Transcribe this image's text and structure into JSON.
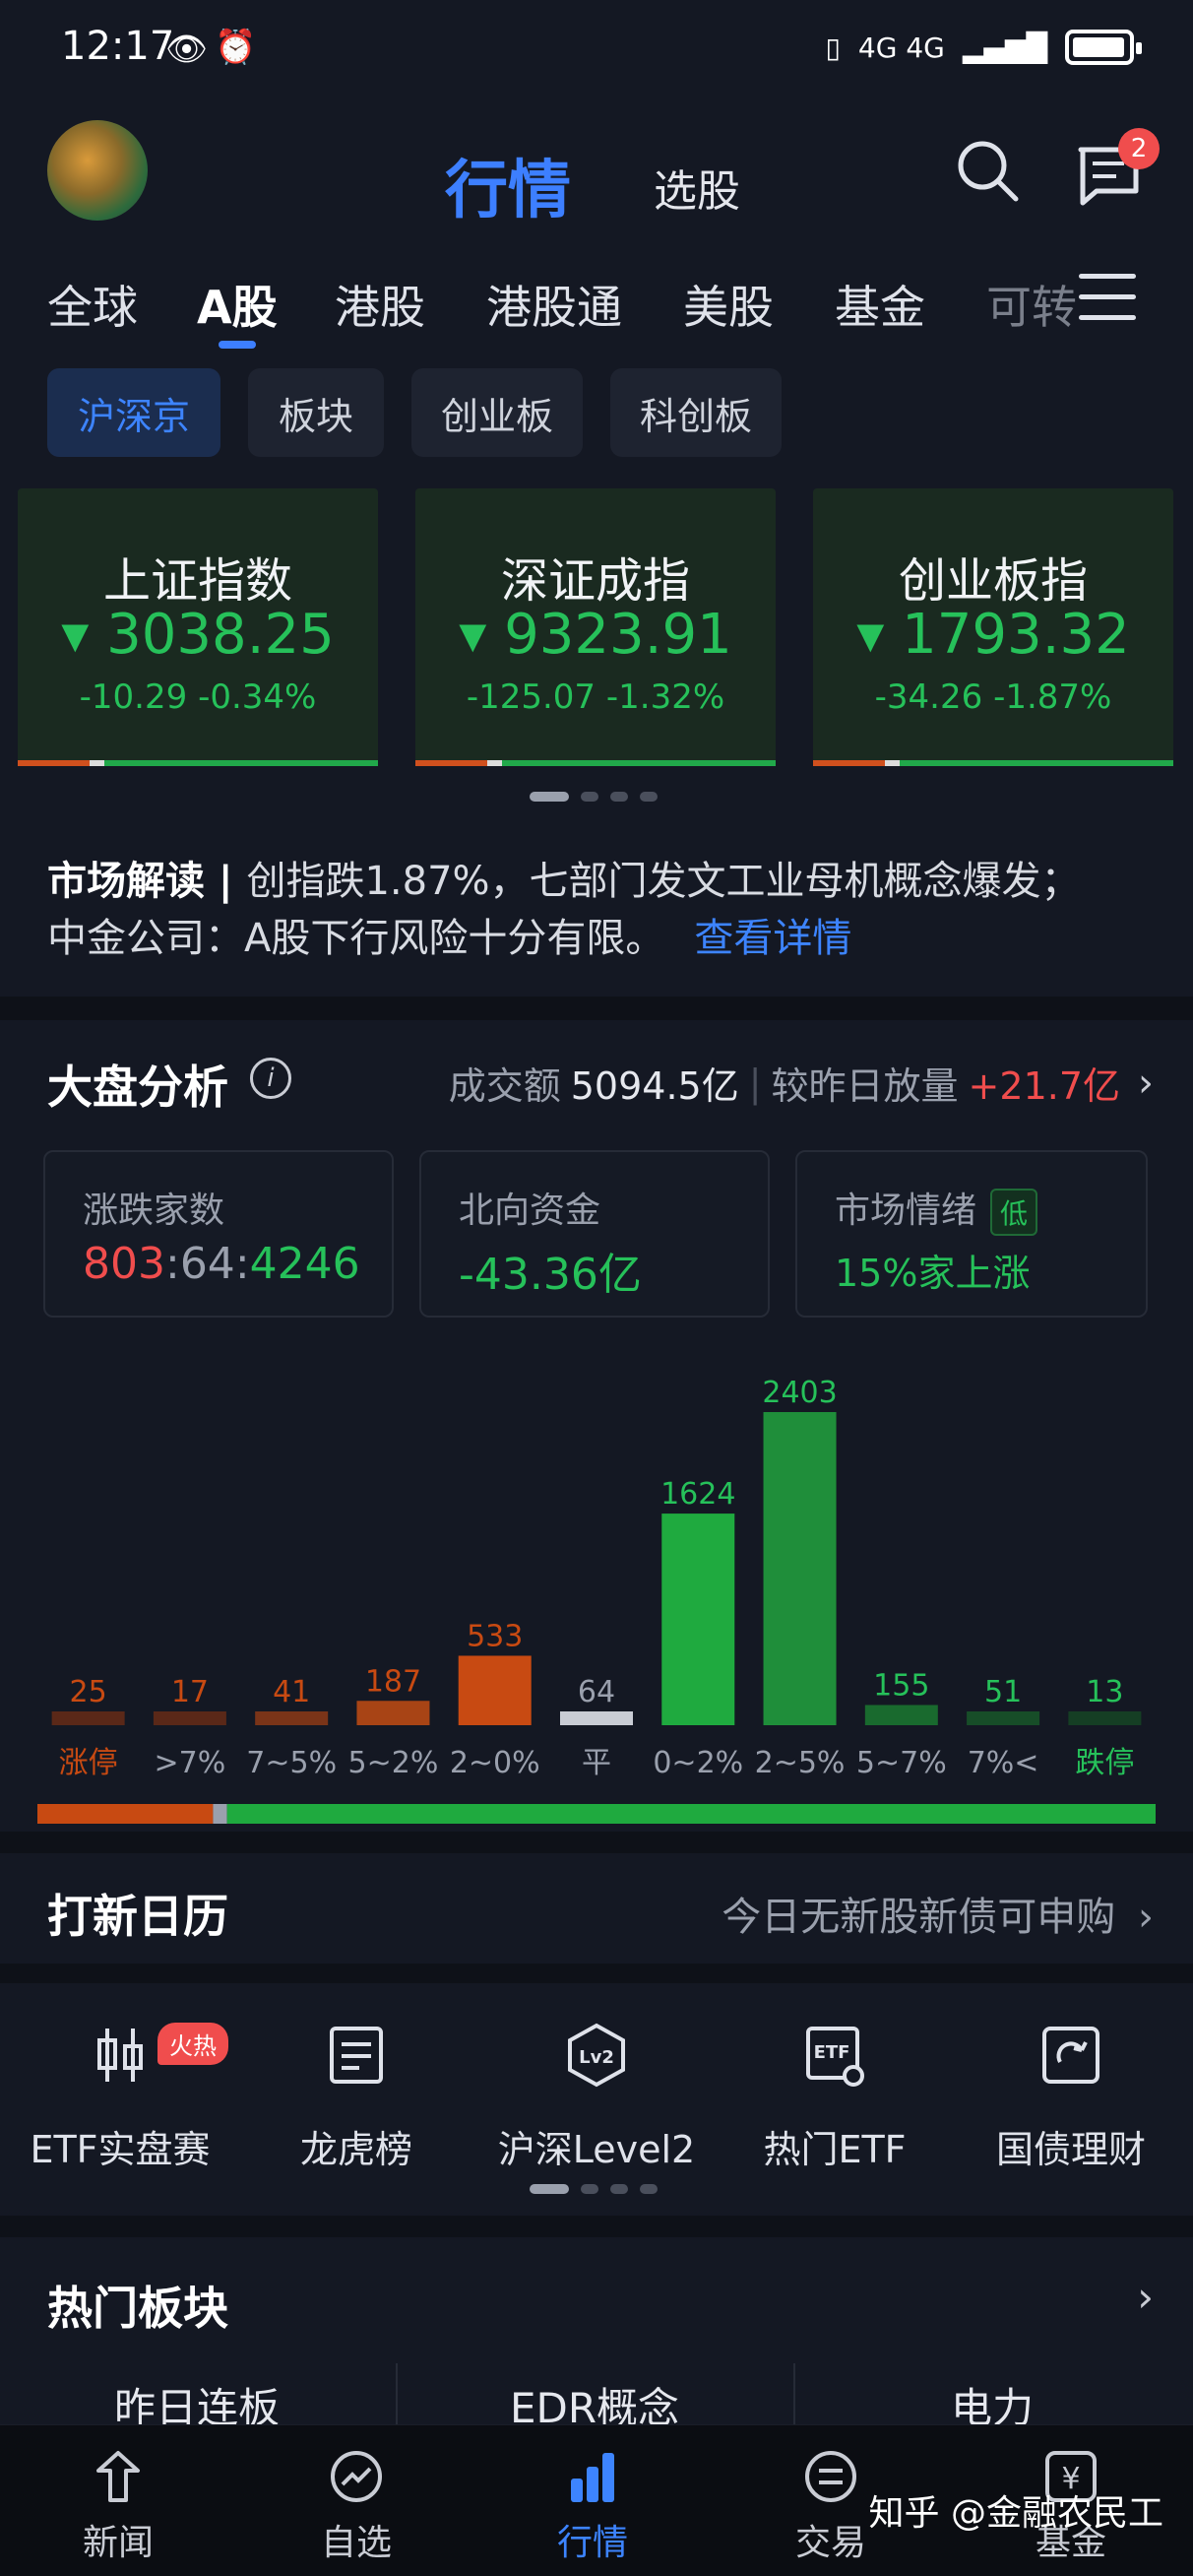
{
  "status_bar": {
    "time": "12:17",
    "network": "4G 4G"
  },
  "header": {
    "title": "行情",
    "subtitle": "选股",
    "message_badge": "2"
  },
  "market_tabs": [
    "全球",
    "A股",
    "港股",
    "港股通",
    "美股",
    "基金",
    "可转"
  ],
  "sub_tabs": [
    "沪深京",
    "板块",
    "创业板",
    "科创板"
  ],
  "indices": [
    {
      "name": "上证指数",
      "value": "3038.25",
      "change": "-10.29",
      "pct": "-0.34%"
    },
    {
      "name": "深证成指",
      "value": "9323.91",
      "change": "-125.07",
      "pct": "-1.32%"
    },
    {
      "name": "创业板指",
      "value": "1793.32",
      "change": "-34.26",
      "pct": "-1.87%"
    }
  ],
  "interpretation": {
    "label": "市场解读",
    "line1": "创指跌1.87%，七部门发文工业母机概念爆发；",
    "line2": "中金公司：A股下行风险十分有限。",
    "link": "查看详情"
  },
  "analysis": {
    "title": "大盘分析",
    "turnover_label": "成交额",
    "turnover": "5094.5亿",
    "vol_label": "较昨日放量",
    "vol_change": "+21.7亿",
    "boxes": {
      "updown_label": "涨跌家数",
      "up": "803",
      "flat": "64",
      "down": "4246",
      "north_label": "北向资金",
      "north_value": "-43.36亿",
      "mood_label": "市场情绪",
      "mood_tag": "低",
      "mood_value": "15%家上涨"
    }
  },
  "chart_data": {
    "type": "bar",
    "categories": [
      "涨停",
      ">7%",
      "7~5%",
      "5~2%",
      "2~0%",
      "平",
      "0~2%",
      "2~5%",
      "5~7%",
      "7%<",
      "跌停"
    ],
    "values": [
      25,
      17,
      41,
      187,
      533,
      64,
      1624,
      2403,
      155,
      51,
      13
    ],
    "colors": [
      "#5a2818",
      "#5a2818",
      "#7a3418",
      "#a84415",
      "#c84a12",
      "#c9ccd4",
      "#1faa3f",
      "#1f8e3a",
      "#196a2e",
      "#174d28",
      "#153e24"
    ],
    "label_colors": [
      "#c84a12",
      "#c84a12",
      "#c84a12",
      "#c84a12",
      "#c84a12",
      "#9aa0ad",
      "#26c15a",
      "#26c15a",
      "#26c15a",
      "#26c15a",
      "#26c15a"
    ],
    "tick_colors": [
      "#c84a12",
      "#9aa0ad",
      "#9aa0ad",
      "#9aa0ad",
      "#9aa0ad",
      "#9aa0ad",
      "#9aa0ad",
      "#9aa0ad",
      "#9aa0ad",
      "#9aa0ad",
      "#26c15a"
    ],
    "ratio_up": 803,
    "ratio_flat": 64,
    "ratio_down": 4246
  },
  "new_stock": {
    "title": "打新日历",
    "note": "今日无新股新债可申购"
  },
  "tools": [
    {
      "label": "ETF实盘赛",
      "icon": "candlestick-icon",
      "badge": "火热"
    },
    {
      "label": "龙虎榜",
      "icon": "list-doc-icon"
    },
    {
      "label": "沪深Level2",
      "icon": "level2-icon"
    },
    {
      "label": "热门ETF",
      "icon": "etf-icon"
    },
    {
      "label": "国债理财",
      "icon": "bond-icon"
    }
  ],
  "hot_sectors": {
    "title": "热门板块",
    "items": [
      "昨日连板",
      "EDR概念",
      "电力"
    ]
  },
  "bottom_nav": [
    "新闻",
    "自选",
    "行情",
    "交易",
    "基金"
  ],
  "watermark": "知乎 @金融农民工"
}
